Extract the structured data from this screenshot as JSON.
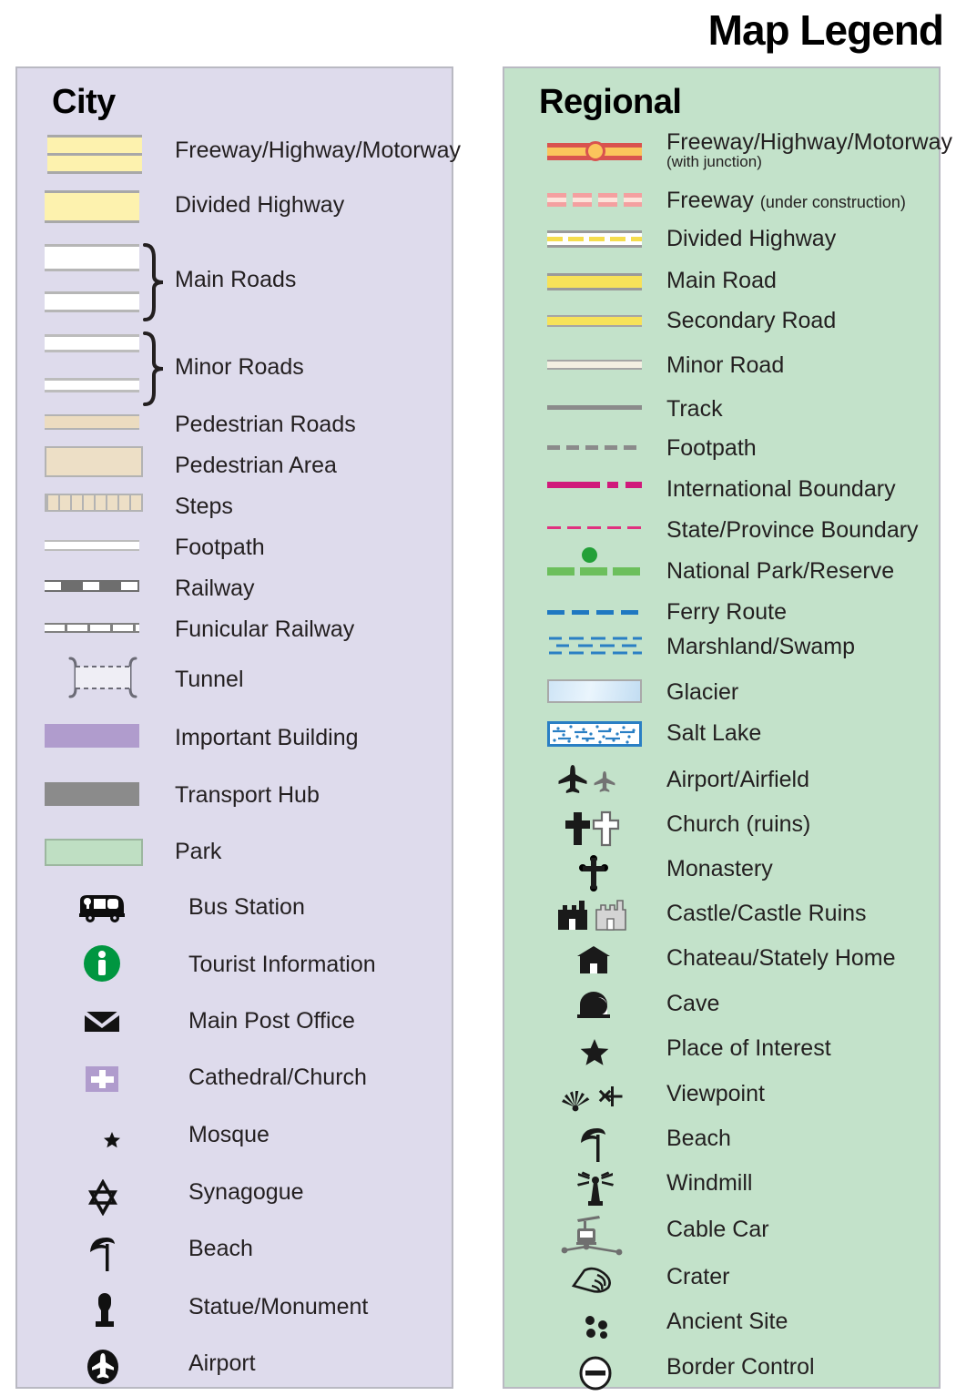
{
  "title": "Map Legend",
  "panels": {
    "city": {
      "heading": "City",
      "bg_color": "#dedbec",
      "items": [
        {
          "label": "Freeway/Highway/Motorway",
          "symbol": "freeway-double-bar"
        },
        {
          "label": "Divided Highway",
          "symbol": "divided-highway-bar"
        },
        {
          "label": "Main Roads",
          "symbol": "main-roads-bracket"
        },
        {
          "label": "Minor Roads",
          "symbol": "minor-roads-bracket"
        },
        {
          "label": "Pedestrian Roads",
          "symbol": "pedestrian-road-bar"
        },
        {
          "label": "Pedestrian Area",
          "symbol": "pedestrian-area-swatch"
        },
        {
          "label": "Steps",
          "symbol": "steps-hatched-bar"
        },
        {
          "label": "Footpath",
          "symbol": "footpath-line"
        },
        {
          "label": "Railway",
          "symbol": "railway-dashed-line"
        },
        {
          "label": "Funicular Railway",
          "symbol": "funicular-railway-line"
        },
        {
          "label": "Tunnel",
          "symbol": "tunnel-bracket-dashed"
        },
        {
          "label": "Important Building",
          "symbol": "important-building-swatch"
        },
        {
          "label": "Transport Hub",
          "symbol": "transport-hub-swatch"
        },
        {
          "label": "Park",
          "symbol": "park-swatch"
        },
        {
          "label": "Bus Station",
          "symbol": "bus-icon"
        },
        {
          "label": "Tourist Information",
          "symbol": "tourist-information-icon"
        },
        {
          "label": "Main Post Office",
          "symbol": "envelope-icon"
        },
        {
          "label": "Cathedral/Church",
          "symbol": "cathedral-cross-icon"
        },
        {
          "label": "Mosque",
          "symbol": "mosque-crescent-icon"
        },
        {
          "label": "Synagogue",
          "symbol": "star-of-david-icon"
        },
        {
          "label": "Beach",
          "symbol": "beach-umbrella-icon"
        },
        {
          "label": "Statue/Monument",
          "symbol": "statue-monument-icon"
        },
        {
          "label": "Airport",
          "symbol": "airport-circle-icon"
        }
      ]
    },
    "regional": {
      "heading": "Regional",
      "bg_color": "#c3e2ca",
      "items": [
        {
          "label": "Freeway/Highway/Motorway",
          "sublabel": "(with junction)",
          "symbol": "regional-freeway-junction"
        },
        {
          "label": "Freeway",
          "inline_sublabel": "(under construction)",
          "symbol": "regional-freeway-under-construction"
        },
        {
          "label": "Divided Highway",
          "symbol": "regional-divided-highway"
        },
        {
          "label": "Main Road",
          "symbol": "regional-main-road"
        },
        {
          "label": "Secondary Road",
          "symbol": "regional-secondary-road"
        },
        {
          "label": "Minor Road",
          "symbol": "regional-minor-road"
        },
        {
          "label": "Track",
          "symbol": "regional-track"
        },
        {
          "label": "Footpath",
          "symbol": "regional-footpath"
        },
        {
          "label": "International Boundary",
          "symbol": "international-boundary"
        },
        {
          "label": "State/Province Boundary",
          "symbol": "state-boundary"
        },
        {
          "label": "National Park/Reserve",
          "symbol": "national-park-boundary"
        },
        {
          "label": "Ferry Route",
          "symbol": "ferry-route"
        },
        {
          "label": "Marshland/Swamp",
          "symbol": "marshland-swamp-pattern"
        },
        {
          "label": "Glacier",
          "symbol": "glacier-swatch"
        },
        {
          "label": "Salt Lake",
          "symbol": "salt-lake-swatch"
        },
        {
          "label": "Airport/Airfield",
          "symbol": "airplane-icon"
        },
        {
          "label": "Church (ruins)",
          "symbol": "church-cross-icon"
        },
        {
          "label": "Monastery",
          "symbol": "monastery-cross-icon"
        },
        {
          "label": "Castle/Castle Ruins",
          "symbol": "castle-icon"
        },
        {
          "label": "Chateau/Stately Home",
          "symbol": "chateau-icon"
        },
        {
          "label": "Cave",
          "symbol": "cave-icon"
        },
        {
          "label": "Place of Interest",
          "symbol": "star-icon"
        },
        {
          "label": "Viewpoint",
          "symbol": "viewpoint-icon"
        },
        {
          "label": "Beach",
          "symbol": "beach-umbrella-icon"
        },
        {
          "label": "Windmill",
          "symbol": "windmill-icon"
        },
        {
          "label": "Cable Car",
          "symbol": "cable-car-icon"
        },
        {
          "label": "Crater",
          "symbol": "crater-icon"
        },
        {
          "label": "Ancient Site",
          "symbol": "ancient-site-icon"
        },
        {
          "label": "Border Control",
          "symbol": "border-control-icon"
        }
      ]
    }
  },
  "colors": {
    "city_panel": "#dedbec",
    "regional_panel": "#c3e2ca",
    "highway_yellow": "#fdf2ae",
    "freeway_red": "#d9534f",
    "freeway_orange": "#fbc55c",
    "boundary_magenta": "#d01a7b",
    "park_green": "#6cbf5c",
    "ferry_blue": "#1f78c1",
    "important_building": "#b09ccd",
    "transport_hub": "#8b8b8b",
    "park_fill": "#bfdfc3",
    "pedestrian": "#eddfc6",
    "tourist_green": "#009640"
  }
}
